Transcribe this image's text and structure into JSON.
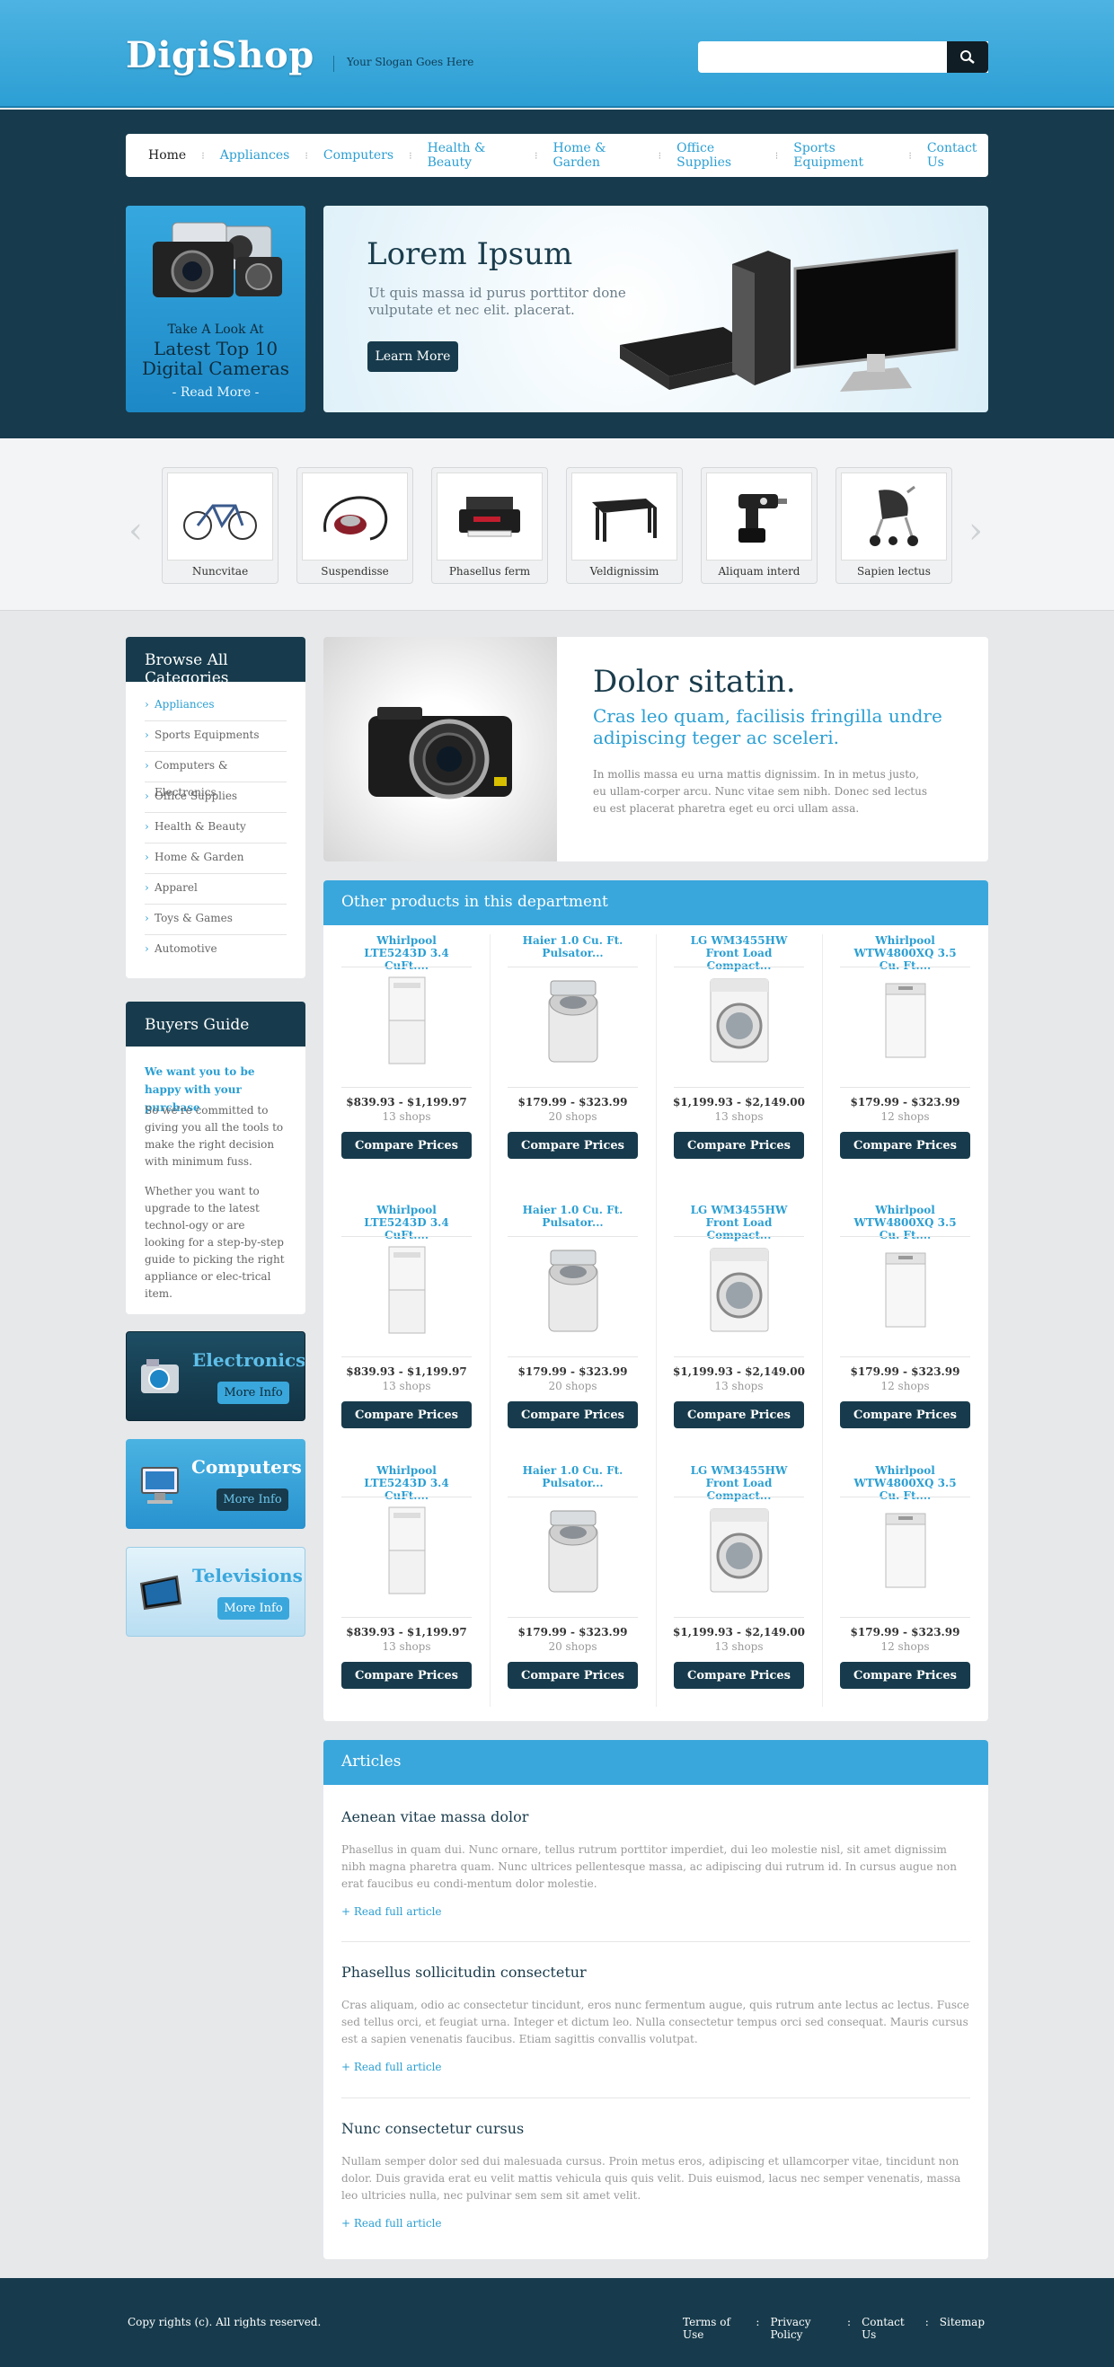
{
  "header": {
    "logo": "DigiShop",
    "slogan": "Your Slogan Goes Here",
    "search_placeholder": ""
  },
  "nav": {
    "items": [
      "Home",
      "Appliances",
      "Computers",
      "Health & Beauty",
      "Home & Garden",
      "Office Supplies",
      "Sports Equipment",
      "Contact Us"
    ]
  },
  "promo": {
    "line1": "Take A Look At",
    "line2": "Latest Top 10",
    "line3": "Digital Cameras",
    "more": "- Read More -"
  },
  "banner": {
    "title": "Lorem Ipsum",
    "text": "Ut quis massa id purus porttitor done vulputate et nec elit. placerat.",
    "button": "Learn More"
  },
  "carousel": {
    "items": [
      {
        "label": "Nuncvitae",
        "icon": "bicycle-icon"
      },
      {
        "label": "Suspendisse",
        "icon": "vacuum-icon"
      },
      {
        "label": "Phasellus ferm",
        "icon": "printer-icon"
      },
      {
        "label": "Veldignissim",
        "icon": "table-icon"
      },
      {
        "label": "Aliquam interd",
        "icon": "drill-icon"
      },
      {
        "label": "Sapien lectus",
        "icon": "stroller-icon"
      }
    ]
  },
  "sidebar": {
    "categories_title": "Browse All Categories",
    "categories": [
      "Appliances",
      "Sports Equipments",
      "Computers & Electronics",
      "Office Supplies",
      "Health & Beauty",
      "Home & Garden",
      "Apparel",
      "Toys & Games",
      "Automotive"
    ],
    "guide_title": "Buyers Guide",
    "guide_lead": "We want you to be happy with your purchase",
    "guide_p1": "So we're committed to giving you all the tools to make the right decision with minimum fuss.",
    "guide_p2": "Whether you want to upgrade to the latest technol-ogy or are looking for a step-by-step guide to picking the right appliance or elec-trical item.",
    "ads": [
      {
        "title": "Electronics",
        "button": "More Info"
      },
      {
        "title": "Computers",
        "button": "More Info"
      },
      {
        "title": "Televisions",
        "button": "More Info"
      }
    ]
  },
  "feature": {
    "title": "Dolor sitatin.",
    "subtitle": "Cras leo quam, facilisis fringilla undre adipiscing teger ac sceleri.",
    "text": "In mollis massa eu urna mattis dignissim. In in metus justo, eu ullam-corper arcu. Nunc vitae sem nibh. Donec sed lectus eu est placerat pharetra eget eu orci ullam assa."
  },
  "products": {
    "title": "Other products in this department",
    "button": "Compare Prices",
    "rows": [
      [
        {
          "name": "Whirlpool LTE5243D 3.4 CuFt....",
          "price": "$839.93 - $1,199.97",
          "shops": "13 shops"
        },
        {
          "name": "Haier 1.0 Cu. Ft. Pulsator...",
          "price": "$179.99 - $323.99",
          "shops": "20 shops"
        },
        {
          "name": "LG WM3455HW Front Load Compact...",
          "price": "$1,199.93 - $2,149.00",
          "shops": "13 shops"
        },
        {
          "name": "Whirlpool WTW4800XQ 3.5 Cu. Ft....",
          "price": "$179.99 - $323.99",
          "shops": "12 shops"
        }
      ],
      [
        {
          "name": "Whirlpool LTE5243D 3.4 CuFt....",
          "price": "$839.93 - $1,199.97",
          "shops": "13 shops"
        },
        {
          "name": "Haier 1.0 Cu. Ft. Pulsator...",
          "price": "$179.99 - $323.99",
          "shops": "20 shops"
        },
        {
          "name": "LG WM3455HW Front Load Compact...",
          "price": "$1,199.93 - $2,149.00",
          "shops": "13 shops"
        },
        {
          "name": "Whirlpool WTW4800XQ 3.5 Cu. Ft....",
          "price": "$179.99 - $323.99",
          "shops": "12 shops"
        }
      ],
      [
        {
          "name": "Whirlpool LTE5243D 3.4 CuFt....",
          "price": "$839.93 - $1,199.97",
          "shops": "13 shops"
        },
        {
          "name": "Haier 1.0 Cu. Ft. Pulsator...",
          "price": "$179.99 - $323.99",
          "shops": "20 shops"
        },
        {
          "name": "LG WM3455HW Front Load Compact...",
          "price": "$1,199.93 - $2,149.00",
          "shops": "13 shops"
        },
        {
          "name": "Whirlpool WTW4800XQ 3.5 Cu. Ft....",
          "price": "$179.99 - $323.99",
          "shops": "12 shops"
        }
      ]
    ]
  },
  "articles": {
    "title": "Articles",
    "link": "+ Read full article",
    "items": [
      {
        "title": "Aenean vitae massa dolor",
        "text": "Phasellus in quam dui. Nunc ornare, tellus rutrum porttitor imperdiet, dui leo molestie nisl, sit amet dignissim nibh magna pharetra quam. Nunc ultrices pellentesque massa, ac adipiscing dui rutrum id. In cursus augue non erat faucibus eu condi-mentum dolor molestie."
      },
      {
        "title": "Phasellus sollicitudin consectetur",
        "text": "Cras aliquam, odio ac consectetur tincidunt, eros nunc fermentum augue, quis rutrum ante lectus ac lectus. Fusce sed tellus orci, et feugiat urna. Integer et dictum leo. Nulla consectetur tempus orci sed consequat. Mauris cursus est a sapien venenatis faucibus. Etiam sagittis convallis volutpat."
      },
      {
        "title": "Nunc consectetur cursus",
        "text": "Nullam semper dolor sed dui malesuada cursus. Proin metus eros, adipiscing et ullamcorper vitae, tincidunt non dolor. Duis gravida erat eu velit mattis vehicula quis quis velit. Duis euismod, lacus nec semper venenatis, massa leo ultricies nulla, nec pulvinar sem sem sit amet velit."
      }
    ]
  },
  "footer": {
    "copyright": "Copy rights (c). All rights reserved.",
    "links": [
      "Terms of Use",
      "Privacy Policy",
      "Contact Us",
      "Sitemap"
    ]
  },
  "colors": {
    "brand_blue": "#2b9fd3",
    "dark_navy": "#173b4c"
  }
}
